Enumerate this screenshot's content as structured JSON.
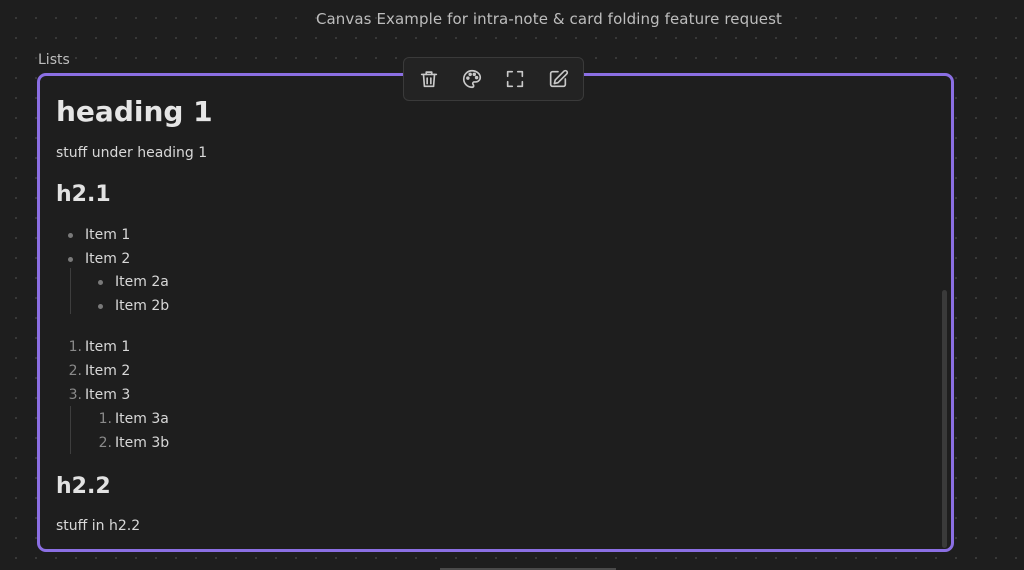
{
  "window": {
    "title": "Canvas Example for intra-note & card folding feature request"
  },
  "node": {
    "label": "Lists"
  },
  "toolbar": {
    "buttons": [
      {
        "icon": "trash-icon"
      },
      {
        "icon": "palette-icon"
      },
      {
        "icon": "zoom-to-fit-icon"
      },
      {
        "icon": "edit-icon"
      }
    ]
  },
  "card": {
    "border_color": "#8b6fe3",
    "heading1": "heading 1",
    "para1": "stuff under heading 1",
    "h2_1": "h2.1",
    "bullets": {
      "item1": "Item 1",
      "item2": "Item 2",
      "item2a": "Item 2a",
      "item2b": "Item 2b"
    },
    "numbered": {
      "n1": "1.",
      "n2": "2.",
      "n3": "3.",
      "item1": "Item 1",
      "item2": "Item 2",
      "item3": "Item 3",
      "sub_n1": "1.",
      "sub_n2": "2.",
      "item3a": "Item 3a",
      "item3b": "Item 3b"
    },
    "h2_2": "h2.2",
    "para2": "stuff in h2.2"
  }
}
